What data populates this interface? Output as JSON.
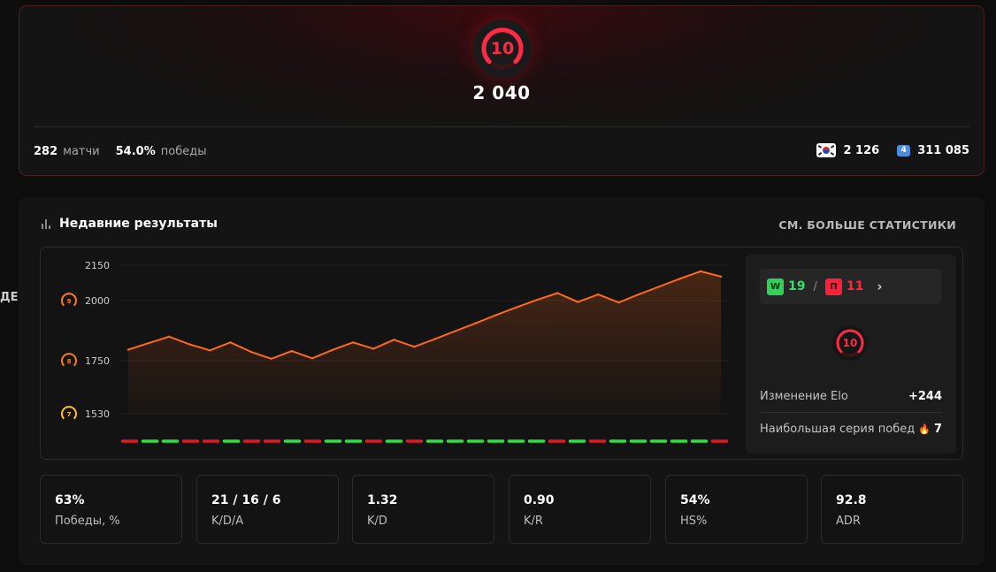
{
  "profile": {
    "level": "10",
    "elo": "2 040",
    "matches_count": "282",
    "matches_label": "матчи",
    "win_rate": "54.0%",
    "win_rate_label": "победы",
    "country_rank": "2 126",
    "country_flag": "south-korea-flag-icon",
    "region_badge": "4",
    "region_rank": "311 085"
  },
  "side_text": "ДЕ",
  "recent": {
    "title": "Недавние результаты",
    "see_more": "СМ. БОЛЬШЕ СТАТИСТИКИ",
    "wins_badge": "W",
    "wins": "19",
    "losses_badge": "П",
    "losses": "11",
    "level": "10",
    "elo_change_label": "Изменение Elo",
    "elo_change_value": "+244",
    "streak_label": "Наибольшая серия побед",
    "streak_value": "7"
  },
  "chart_data": {
    "type": "line",
    "y_ticks": [
      2150,
      2000,
      1750,
      1530
    ],
    "level_markers": [
      {
        "level": "9",
        "elo": 2000,
        "color": "#ff7a1a"
      },
      {
        "level": "8",
        "elo": 1750,
        "color": "#ff7a1a"
      },
      {
        "level": "7",
        "elo": 1530,
        "color": "#ffc21a"
      }
    ],
    "x": [
      1,
      2,
      3,
      4,
      5,
      6,
      7,
      8,
      9,
      10,
      11,
      12,
      13,
      14,
      15,
      16,
      17,
      18,
      19,
      20,
      21,
      22,
      23,
      24,
      25,
      26,
      27,
      28,
      29,
      30
    ],
    "values": [
      1796,
      1823,
      1850,
      1818,
      1793,
      1826,
      1787,
      1758,
      1790,
      1760,
      1795,
      1826,
      1800,
      1837,
      1808,
      1840,
      1873,
      1906,
      1940,
      1972,
      2003,
      2032,
      1994,
      2026,
      1992,
      2027,
      2060,
      2093,
      2124,
      2102
    ],
    "results": [
      "L",
      "W",
      "W",
      "L",
      "L",
      "W",
      "L",
      "L",
      "W",
      "L",
      "W",
      "W",
      "L",
      "W",
      "L",
      "W",
      "W",
      "W",
      "W",
      "W",
      "W",
      "L",
      "W",
      "L",
      "W",
      "W",
      "W",
      "W",
      "W",
      "L"
    ],
    "colors": {
      "line": "#ff6a1a",
      "win": "#2ee040",
      "loss": "#e01a24"
    },
    "grid": true
  },
  "stats": [
    {
      "value": "63%",
      "label": "Победы, %"
    },
    {
      "value": "21 / 16 / 6",
      "label": "K/D/A"
    },
    {
      "value": "1.32",
      "label": "K/D"
    },
    {
      "value": "0.90",
      "label": "K/R"
    },
    {
      "value": "54%",
      "label": "HS%"
    },
    {
      "value": "92.8",
      "label": "ADR"
    }
  ],
  "colors": {
    "accent": "#ff2a45",
    "background": "#0d0d0d",
    "card": "#141414"
  }
}
